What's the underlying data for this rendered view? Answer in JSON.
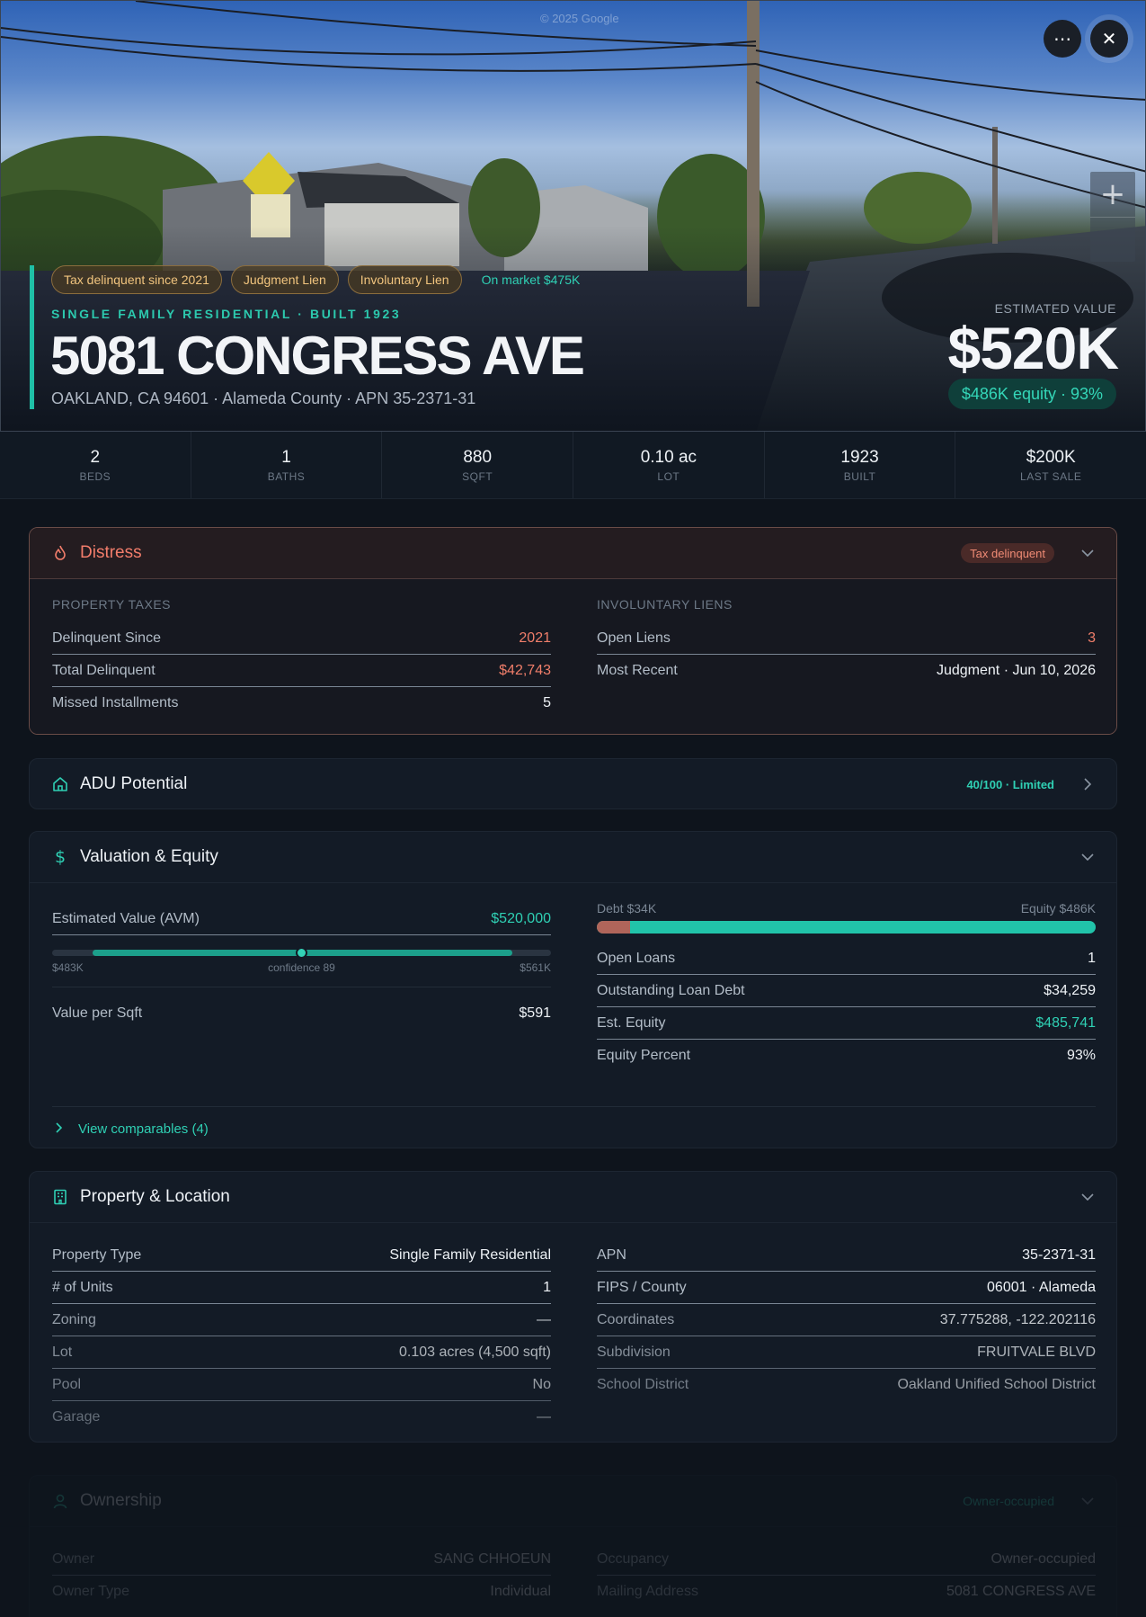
{
  "hero": {
    "watermark": "© 2025 Google",
    "chips": [
      "Tax delinquent since 2021",
      "Judgment Lien",
      "Involuntary Lien"
    ],
    "market_chip": "On market $475K",
    "subtitle": "SINGLE FAMILY RESIDENTIAL · BUILT 1923",
    "title": "5081 CONGRESS AVE",
    "address": "OAKLAND, CA 94601 · Alameda County · APN 35-2371-31",
    "est_label": "ESTIMATED VALUE",
    "est_value": "$520K",
    "equity_pill": "$486K equity · 93%",
    "more_icon": "⋯",
    "close_icon": "✕",
    "zoom_icon": "+"
  },
  "stats": [
    {
      "value": "2",
      "label": "BEDS"
    },
    {
      "value": "1",
      "label": "BATHS"
    },
    {
      "value": "880",
      "label": "SQFT"
    },
    {
      "value": "0.10 ac",
      "label": "LOT"
    },
    {
      "value": "1923",
      "label": "BUILT"
    },
    {
      "value": "$200K",
      "label": "LAST SALE"
    }
  ],
  "distress": {
    "title": "Distress",
    "badge": "Tax delinquent",
    "left_label": "PROPERTY TAXES",
    "left_rows": [
      {
        "k": "Delinquent Since",
        "v": "2021"
      },
      {
        "k": "Total Delinquent",
        "v": "$42,743"
      },
      {
        "k": "Missed Installments",
        "v": "5"
      }
    ],
    "right_label": "INVOLUNTARY LIENS",
    "right_rows": [
      {
        "k": "Open Liens",
        "v": "3"
      },
      {
        "k": "Most Recent",
        "v": "Judgment · Jun 10, 2026"
      }
    ]
  },
  "adu": {
    "title": "ADU Potential",
    "badge": "40/100 · Limited"
  },
  "valuation": {
    "title": "Valuation & Equity",
    "avm_label": "Estimated Value (AVM)",
    "avm_value": "$520,000",
    "range_low": "$483K",
    "confidence": "confidence 89",
    "range_high": "$561K",
    "per_sqft_label": "Value per Sqft",
    "per_sqft_value": "$591",
    "debt_label": "Debt $34K",
    "equity_label": "Equity $486K",
    "debt_fraction": 0.066,
    "rows": [
      {
        "k": "Open Loans",
        "v": "1"
      },
      {
        "k": "Outstanding Loan Debt",
        "v": "$34,259"
      },
      {
        "k": "Est. Equity",
        "v": "$485,741"
      },
      {
        "k": "Equity Percent",
        "v": "93%"
      }
    ],
    "comps_link": "View comparables (4)"
  },
  "property": {
    "title": "Property & Location",
    "left_rows": [
      {
        "k": "Property Type",
        "v": "Single Family Residential"
      },
      {
        "k": "# of Units",
        "v": "1"
      },
      {
        "k": "Zoning",
        "v": "—"
      },
      {
        "k": "Lot",
        "v": "0.103 acres (4,500 sqft)"
      },
      {
        "k": "Pool",
        "v": "No"
      },
      {
        "k": "Garage",
        "v": "—"
      }
    ],
    "right_rows": [
      {
        "k": "APN",
        "v": "35-2371-31"
      },
      {
        "k": "FIPS / County",
        "v": "06001 · Alameda"
      },
      {
        "k": "Coordinates",
        "v": "37.775288, -122.202116"
      },
      {
        "k": "Subdivision",
        "v": "FRUITVALE BLVD"
      },
      {
        "k": "School District",
        "v": "Oakland Unified School District"
      }
    ]
  },
  "ownership": {
    "title": "Ownership",
    "badge": "Owner-occupied",
    "left_rows": [
      {
        "k": "Owner",
        "v": "SANG CHHOEUN"
      },
      {
        "k": "Owner Type",
        "v": "Individual"
      }
    ],
    "right_rows": [
      {
        "k": "Occupancy",
        "v": "Owner-occupied"
      },
      {
        "k": "Mailing Address",
        "v": "5081 CONGRESS AVE"
      }
    ]
  },
  "colors": {
    "accent": "#2fd0b4",
    "danger": "#f07e6a",
    "background": "#0e141c"
  }
}
